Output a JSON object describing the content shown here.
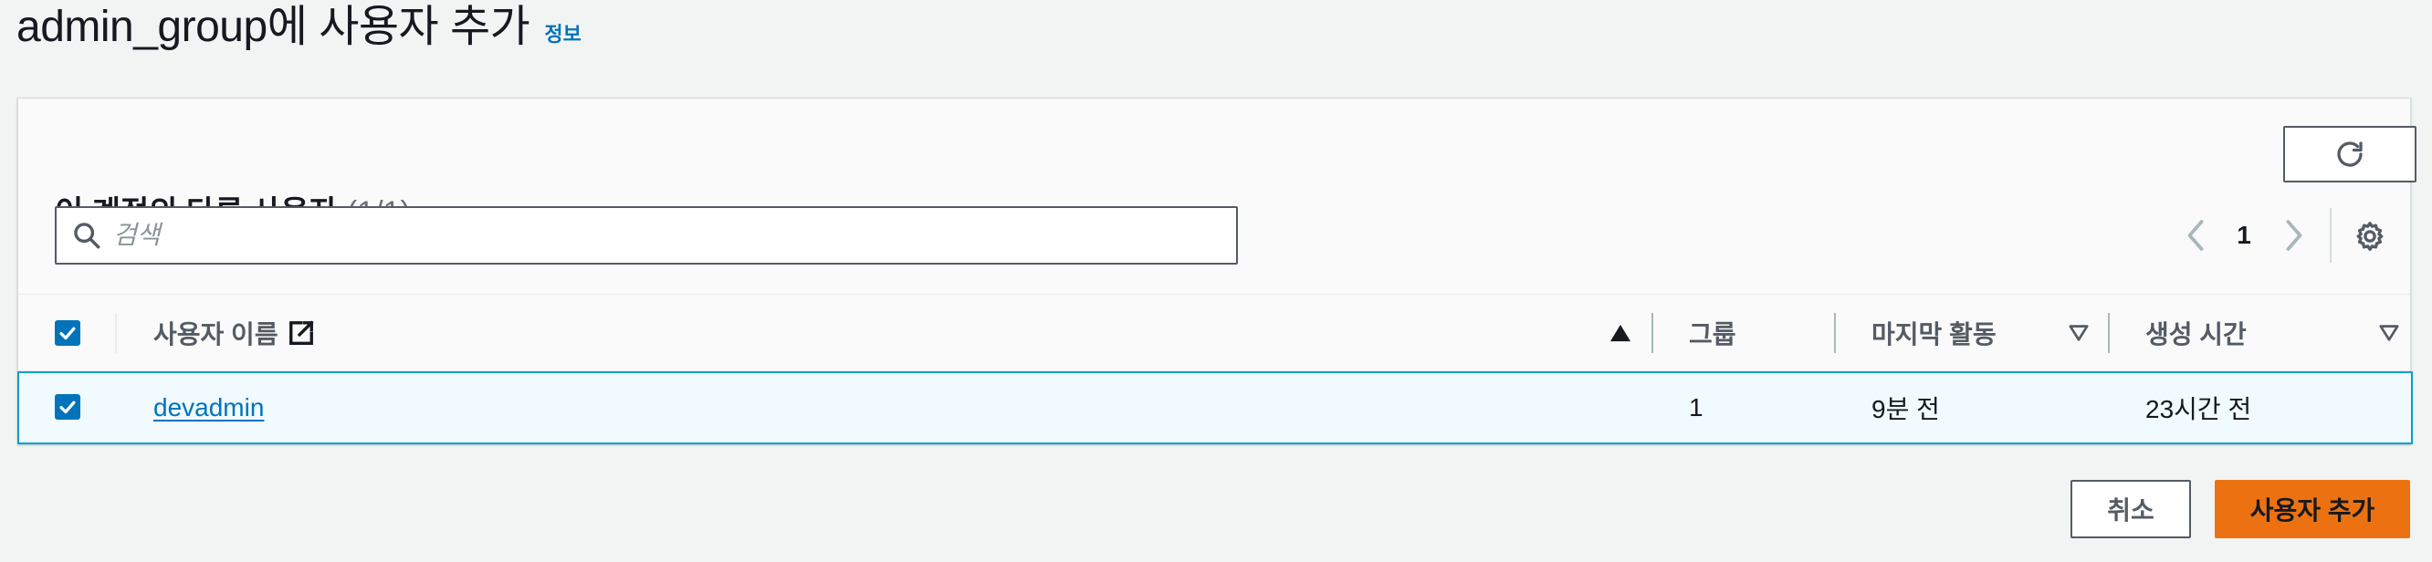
{
  "header": {
    "title": "admin_group에 사용자 추가",
    "info_link": "정보"
  },
  "users_panel": {
    "title": "이 계정의 다른 사용자",
    "count": "(1/1)",
    "search_placeholder": "검색",
    "search_value": "",
    "page_number": "1",
    "columns": {
      "username": "사용자 이름",
      "groups": "그룹",
      "last_activity": "마지막 활동",
      "created": "생성 시간"
    },
    "rows": [
      {
        "username": "devadmin",
        "groups": "1",
        "last_activity": "9분 전",
        "created": "23시간 전",
        "selected": true
      }
    ]
  },
  "footer": {
    "cancel_label": "취소",
    "add_label": "사용자 추가"
  },
  "colors": {
    "primary": "#ec7211",
    "link": "#0073bb",
    "selected_row_bg": "#f1faff",
    "selected_row_border": "#00a1c9"
  },
  "icons": [
    "search-icon",
    "refresh-icon",
    "chevron-left-icon",
    "chevron-right-icon",
    "settings-icon",
    "external-link-icon",
    "sort-ascending-icon",
    "sort-descending-icon",
    "check-icon"
  ]
}
